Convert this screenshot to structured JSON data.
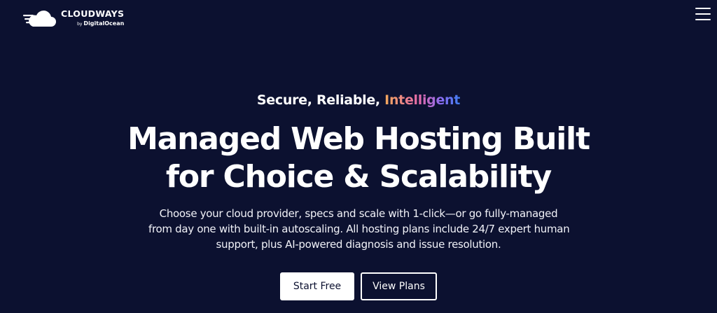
{
  "header": {
    "logo_brand": "CLOUDWAYS",
    "logo_by": "by",
    "logo_sub": "DigitalOcean",
    "logo_icon": "cloud-logo-icon",
    "menu_icon": "hamburger-menu-icon"
  },
  "hero": {
    "eyebrow_plain": "Secure, Reliable, ",
    "eyebrow_accent": "Intelligent",
    "headline_lines": [
      "Managed Web Hosting Built",
      "for Choice & Scalability"
    ],
    "description_lines": [
      "Choose your cloud provider, specs and scale with 1-click—or go fully-managed",
      "from day one with built-in autoscaling. All hosting plans include 24/7 expert human",
      "support, plus AI-powered diagnosis and issue resolution."
    ]
  },
  "cta": {
    "primary_label": "Start Free",
    "secondary_label": "View Plans"
  },
  "colors": {
    "background": "#0c1130",
    "text": "#ffffff",
    "accent_gradient": [
      "#f2a85a",
      "#e56aa8",
      "#8a6cf2",
      "#3f7df0"
    ]
  }
}
